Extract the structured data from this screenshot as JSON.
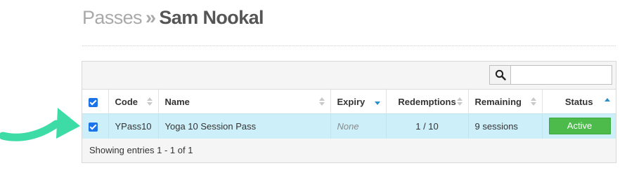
{
  "breadcrumb": {
    "parent": "Passes",
    "separator": "»",
    "current": "Sam Nookal"
  },
  "search": {
    "value": "",
    "icon": "search-icon"
  },
  "table": {
    "columns": [
      "Code",
      "Name",
      "Expiry",
      "Redemptions",
      "Remaining",
      "Status"
    ],
    "sorted_column": "Expiry",
    "rows": [
      {
        "selected": true,
        "code": "YPass10",
        "name": "Yoga 10 Session Pass",
        "expiry": "None",
        "redemptions": "1 / 10",
        "remaining": "9 sessions",
        "status": "Active"
      }
    ]
  },
  "footer": {
    "entries": "Showing entries 1 - 1 of 1"
  },
  "colors": {
    "row_highlight": "#cdeff9",
    "status_active": "#4cbb4c",
    "sort_active": "#2a8fc9",
    "arrow": "#3ddba6"
  }
}
